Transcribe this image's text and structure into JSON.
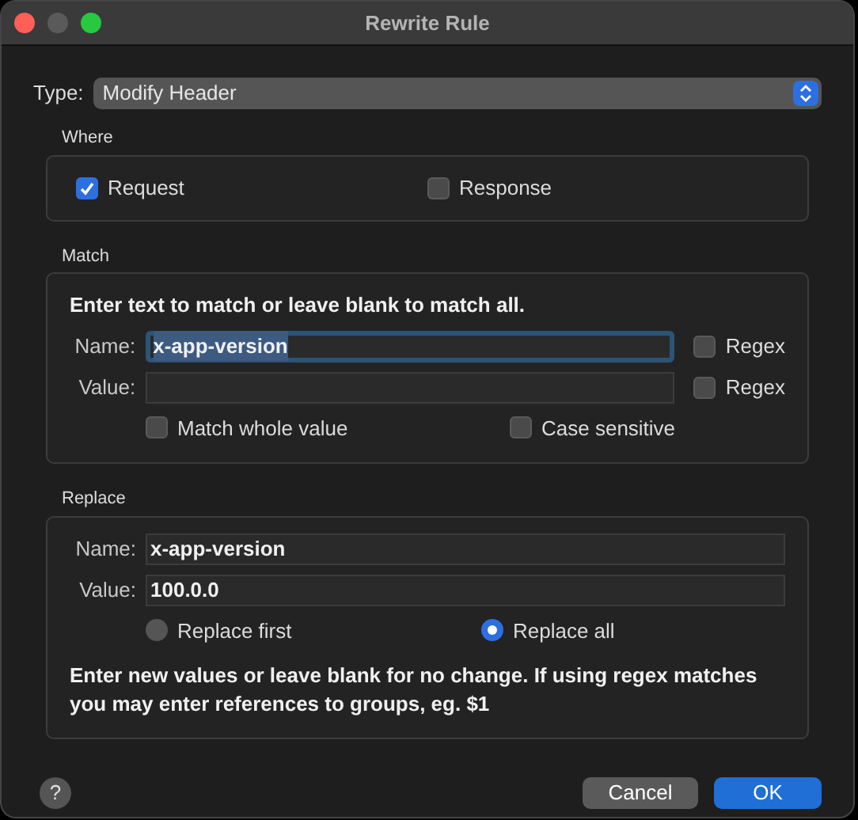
{
  "window": {
    "title": "Rewrite Rule"
  },
  "type_select": {
    "label": "Type:",
    "value": "Modify Header"
  },
  "where": {
    "title": "Where",
    "options": [
      {
        "label": "Request",
        "checked": true
      },
      {
        "label": "Response",
        "checked": false
      }
    ]
  },
  "match": {
    "title": "Match",
    "instruction": "Enter text to match or leave blank to match all.",
    "fields": [
      {
        "label": "Name:",
        "value": "x-app-version",
        "focused": true,
        "regex_label": "Regex",
        "regex_checked": false
      },
      {
        "label": "Value:",
        "focused": false,
        "regex_label": "Regex",
        "regex_checked": false
      }
    ],
    "options": [
      {
        "label": "Match whole value",
        "checked": false
      },
      {
        "label": "Case sensitive",
        "checked": false
      }
    ]
  },
  "replace": {
    "title": "Replace",
    "fields": [
      {
        "label": "Name:",
        "value": "x-app-version"
      },
      {
        "label": "Value:",
        "value": "100.0.0"
      }
    ],
    "modes": [
      {
        "label": "Replace first",
        "selected": false
      },
      {
        "label": "Replace all",
        "selected": true
      }
    ],
    "note": "Enter new values or leave blank for no change. If using regex matches you may enter references to groups, eg. $1"
  },
  "help": "?",
  "buttons": [
    {
      "label": "Cancel",
      "kind": "secondary"
    },
    {
      "label": "OK",
      "kind": "primary"
    }
  ]
}
